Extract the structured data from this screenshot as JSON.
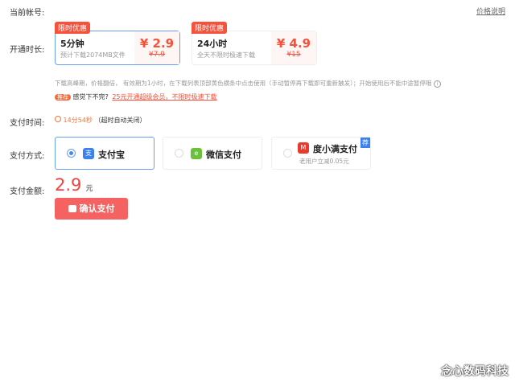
{
  "account": {
    "label": "当前帐号:",
    "price_info": "价格说明"
  },
  "duration": {
    "label": "开通时长:",
    "plans": [
      {
        "tag": "限时优惠",
        "title": "5分钟",
        "desc": "预计下载2074MB文件",
        "price": "¥ 2.9",
        "old_price": "¥7.9"
      },
      {
        "tag": "限时优惠",
        "title": "24小时",
        "desc": "全天不限时极速下载",
        "price": "¥ 4.9",
        "old_price": "¥15"
      }
    ]
  },
  "notice": "下载高峰期，价格翻倍， 有效期为1小时，在下载列表顶部黄色横条中点击使用（手动暂停再下载即可重新触发）；开始使用后不能中途暂停哦",
  "recommend": {
    "badge": "推荐",
    "text": "感觉下不完?",
    "link": "25元开通超级会员，不限时极速下载"
  },
  "pay_time": {
    "label": "支付时间:",
    "countdown": "14分54秒",
    "hint": "（超时自动关闭）"
  },
  "pay_method": {
    "label": "支付方式:",
    "options": [
      {
        "name": "支付宝",
        "icon": "alipay-icon",
        "color": "#3b82f0"
      },
      {
        "name": "微信支付",
        "icon": "wechat-icon",
        "color": "#6cc13b"
      },
      {
        "name": "度小满支付",
        "icon": "duxiaoman-icon",
        "color": "#e63b2e",
        "sub": "老用户立减0.05元",
        "badge": "荐"
      }
    ]
  },
  "amount": {
    "label": "支付金额:",
    "value": "2.9",
    "unit": "元"
  },
  "confirm": "确认支付",
  "watermark": "念心数码科技"
}
